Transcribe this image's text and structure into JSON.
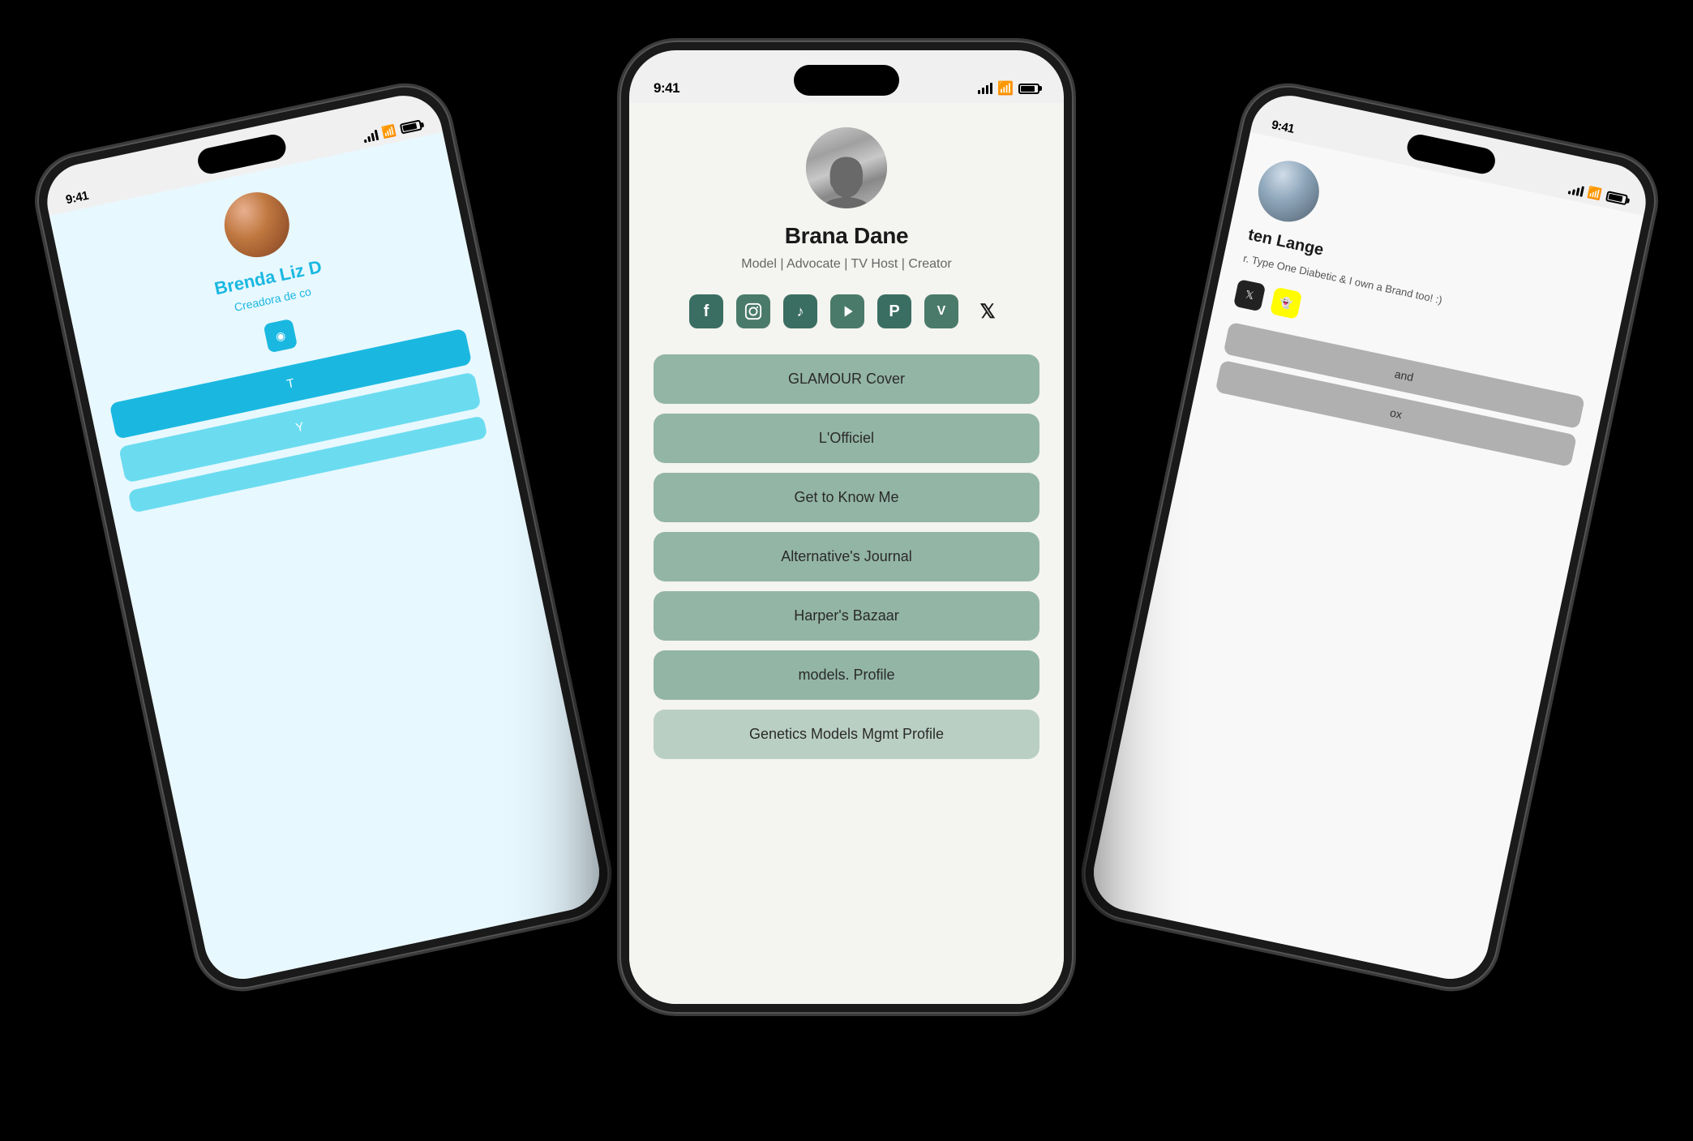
{
  "scene": {
    "background": "#000000"
  },
  "left_phone": {
    "time": "9:41",
    "user_name": "Brenda Liz D",
    "user_bio": "Creadora de co",
    "social_icons": [
      "instagram-icon"
    ],
    "links": [
      "T",
      "Y"
    ]
  },
  "center_phone": {
    "time": "9:41",
    "user_name": "Brana Dane",
    "user_bio": "Model | Advocate | TV Host | Creator",
    "social_icons": [
      {
        "name": "facebook-icon",
        "label": "f"
      },
      {
        "name": "instagram-icon",
        "label": "◉"
      },
      {
        "name": "tiktok-icon",
        "label": "♪"
      },
      {
        "name": "youtube-icon",
        "label": "▶"
      },
      {
        "name": "pinterest-icon",
        "label": "P"
      },
      {
        "name": "venmo-icon",
        "label": "V"
      },
      {
        "name": "x-icon",
        "label": "𝕏"
      }
    ],
    "links": [
      {
        "label": "GLAMOUR Cover"
      },
      {
        "label": "L'Officiel"
      },
      {
        "label": "Get to Know Me"
      },
      {
        "label": "Alternative's Journal"
      },
      {
        "label": "Harper's Bazaar"
      },
      {
        "label": "models. Profile"
      },
      {
        "label": "Genetics Models Mgmt Profile"
      }
    ]
  },
  "right_phone": {
    "time": "9:41",
    "user_name": "ten Lange",
    "user_bio": "r. Type One Diabetic & I own a Brand too! :)",
    "social_icons": [
      "x-icon",
      "snapchat-icon"
    ],
    "links": [
      "and",
      "ox"
    ]
  }
}
